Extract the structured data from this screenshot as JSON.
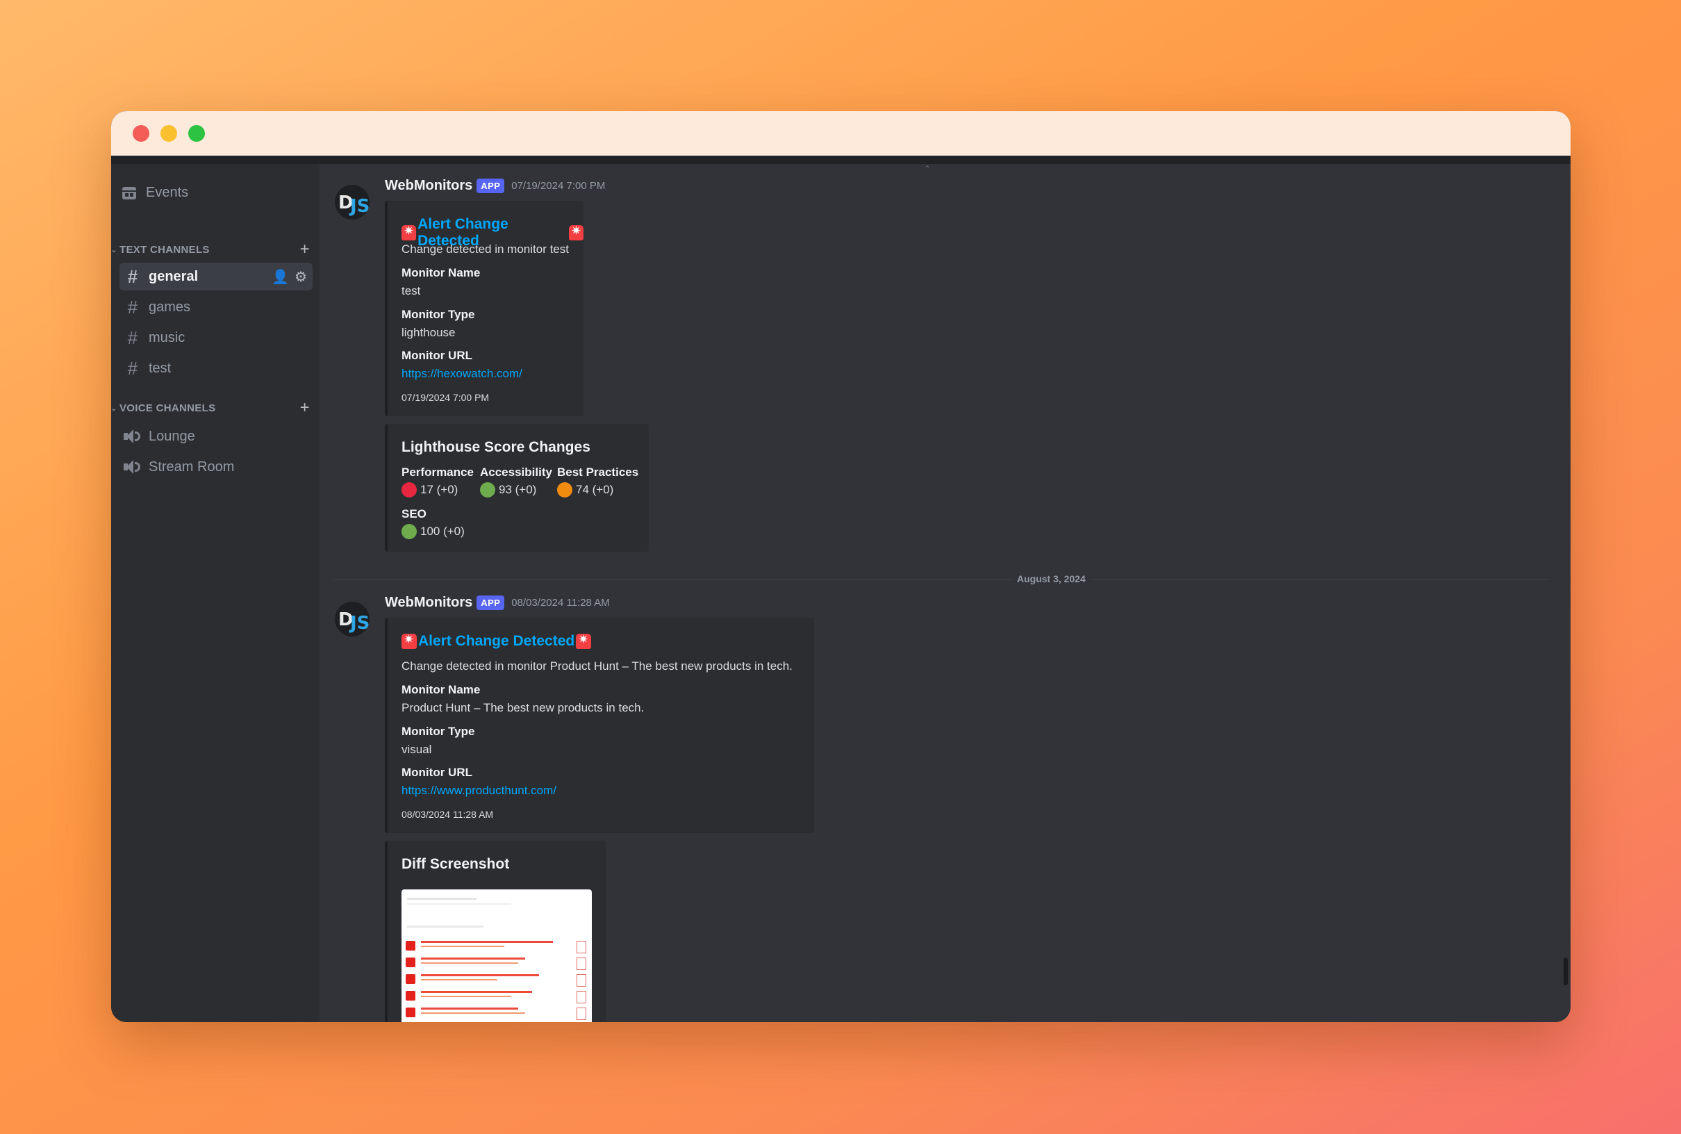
{
  "sidebar": {
    "events_label": "Events",
    "text_category": "TEXT CHANNELS",
    "voice_category": "VOICE CHANNELS",
    "text_channels": [
      "general",
      "games",
      "music",
      "test"
    ],
    "voice_channels": [
      "Lounge",
      "Stream Room"
    ]
  },
  "messages": [
    {
      "author": "WebMonitors",
      "badge": "APP",
      "time": "07/19/2024 7:00 PM",
      "avatar_letters": [
        "D",
        "JS"
      ],
      "embed": {
        "title": "Alert Change Detected",
        "description": "Change detected in monitor test",
        "fields": [
          {
            "name": "Monitor Name",
            "value": "test"
          },
          {
            "name": "Monitor Type",
            "value": "lighthouse"
          },
          {
            "name": "Monitor URL",
            "value": "https://hexowatch.com/"
          }
        ],
        "footer": "07/19/2024 7:00 PM"
      },
      "embed2": {
        "title": "Lighthouse Score Changes",
        "scores": [
          {
            "name": "Performance",
            "value": "17 (+0)",
            "color": "#e6273f"
          },
          {
            "name": "Accessibility",
            "value": "93 (+0)",
            "color": "#6fac4e"
          },
          {
            "name": "Best Practices",
            "value": "74 (+0)",
            "color": "#f28c0f"
          },
          {
            "name": "SEO",
            "value": "100 (+0)",
            "color": "#6fac4e"
          }
        ]
      }
    },
    {
      "author": "WebMonitors",
      "badge": "APP",
      "time": "08/03/2024 11:28 AM",
      "avatar_letters": [
        "D",
        "JS"
      ],
      "embed": {
        "title": "Alert Change Detected",
        "description": "Change detected in monitor Product Hunt – The best new products in tech.",
        "fields": [
          {
            "name": "Monitor Name",
            "value": "Product Hunt – The best new products in tech."
          },
          {
            "name": "Monitor Type",
            "value": "visual"
          },
          {
            "name": "Monitor URL",
            "value": "https://www.producthunt.com/"
          }
        ],
        "footer": "08/03/2024 11:28 AM"
      },
      "embed2": {
        "title": "Diff Screenshot"
      }
    }
  ],
  "date_divider": "August 3, 2024",
  "colors": {
    "accent": "#5865f2",
    "link": "#00a8fc",
    "siren": "#f23f43"
  }
}
